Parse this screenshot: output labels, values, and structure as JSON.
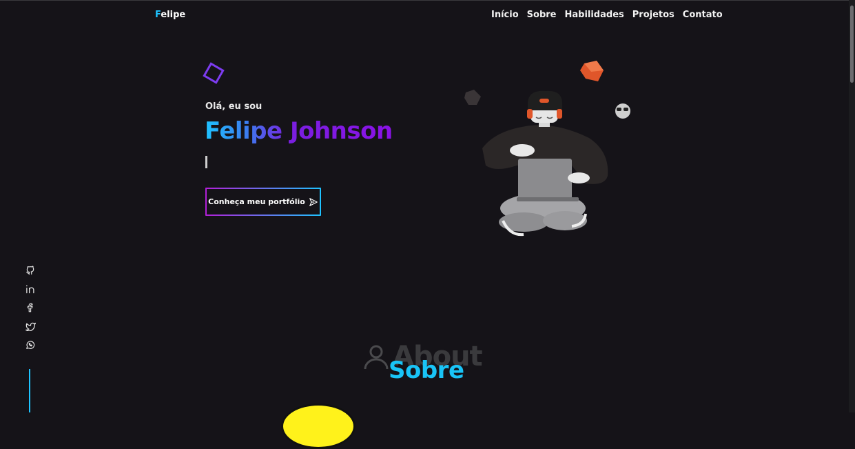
{
  "logo": {
    "first": "F",
    "rest": "elipe"
  },
  "nav": [
    "Início",
    "Sobre",
    "Habilidades",
    "Projetos",
    "Contato"
  ],
  "hero": {
    "greeting": "Olá, eu sou",
    "name": "Felipe Johnson",
    "cta_label": "Conheça meu portfólio"
  },
  "social": [
    "github-icon",
    "linkedin-icon",
    "facebook-icon",
    "twitter-icon",
    "whatsapp-icon"
  ],
  "about": {
    "background_word": "About",
    "title": "Sobre"
  },
  "colors": {
    "accent_cyan": "#1ec3ff",
    "accent_purple": "#8a12e6",
    "background": "#151318",
    "avatar_yellow": "#fff21b"
  }
}
